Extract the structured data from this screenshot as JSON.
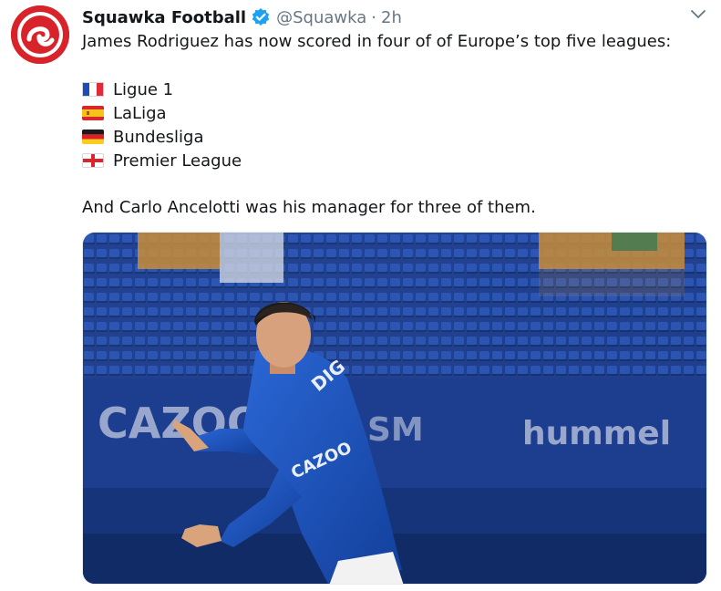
{
  "tweet": {
    "author_name": "Squawka Football",
    "author_handle": "@Squawka",
    "separator": "·",
    "time": "2h",
    "verified": true,
    "intro": "James Rodriguez has now scored in four of of Europe’s top five leagues:",
    "leagues": [
      {
        "flag": "france-flag",
        "label": "Ligue 1"
      },
      {
        "flag": "spain-flag",
        "label": "LaLiga"
      },
      {
        "flag": "germany-flag",
        "label": "Bundesliga"
      },
      {
        "flag": "england-flag",
        "label": "Premier League"
      }
    ],
    "closing": "And Carlo Ancelotti was his manager for three of them."
  },
  "media": {
    "board_left": "CAZOO",
    "board_right": "hummel",
    "board_mid": "SM",
    "shirt_text": "CAZOO"
  },
  "colors": {
    "brand_red": "#d8232a",
    "verified_blue": "#1da1f2",
    "secondary_text": "#657786",
    "everton_blue": "#1e4fa8"
  },
  "icons": {
    "verified": "verified-badge-icon",
    "caret": "chevron-down-icon"
  }
}
